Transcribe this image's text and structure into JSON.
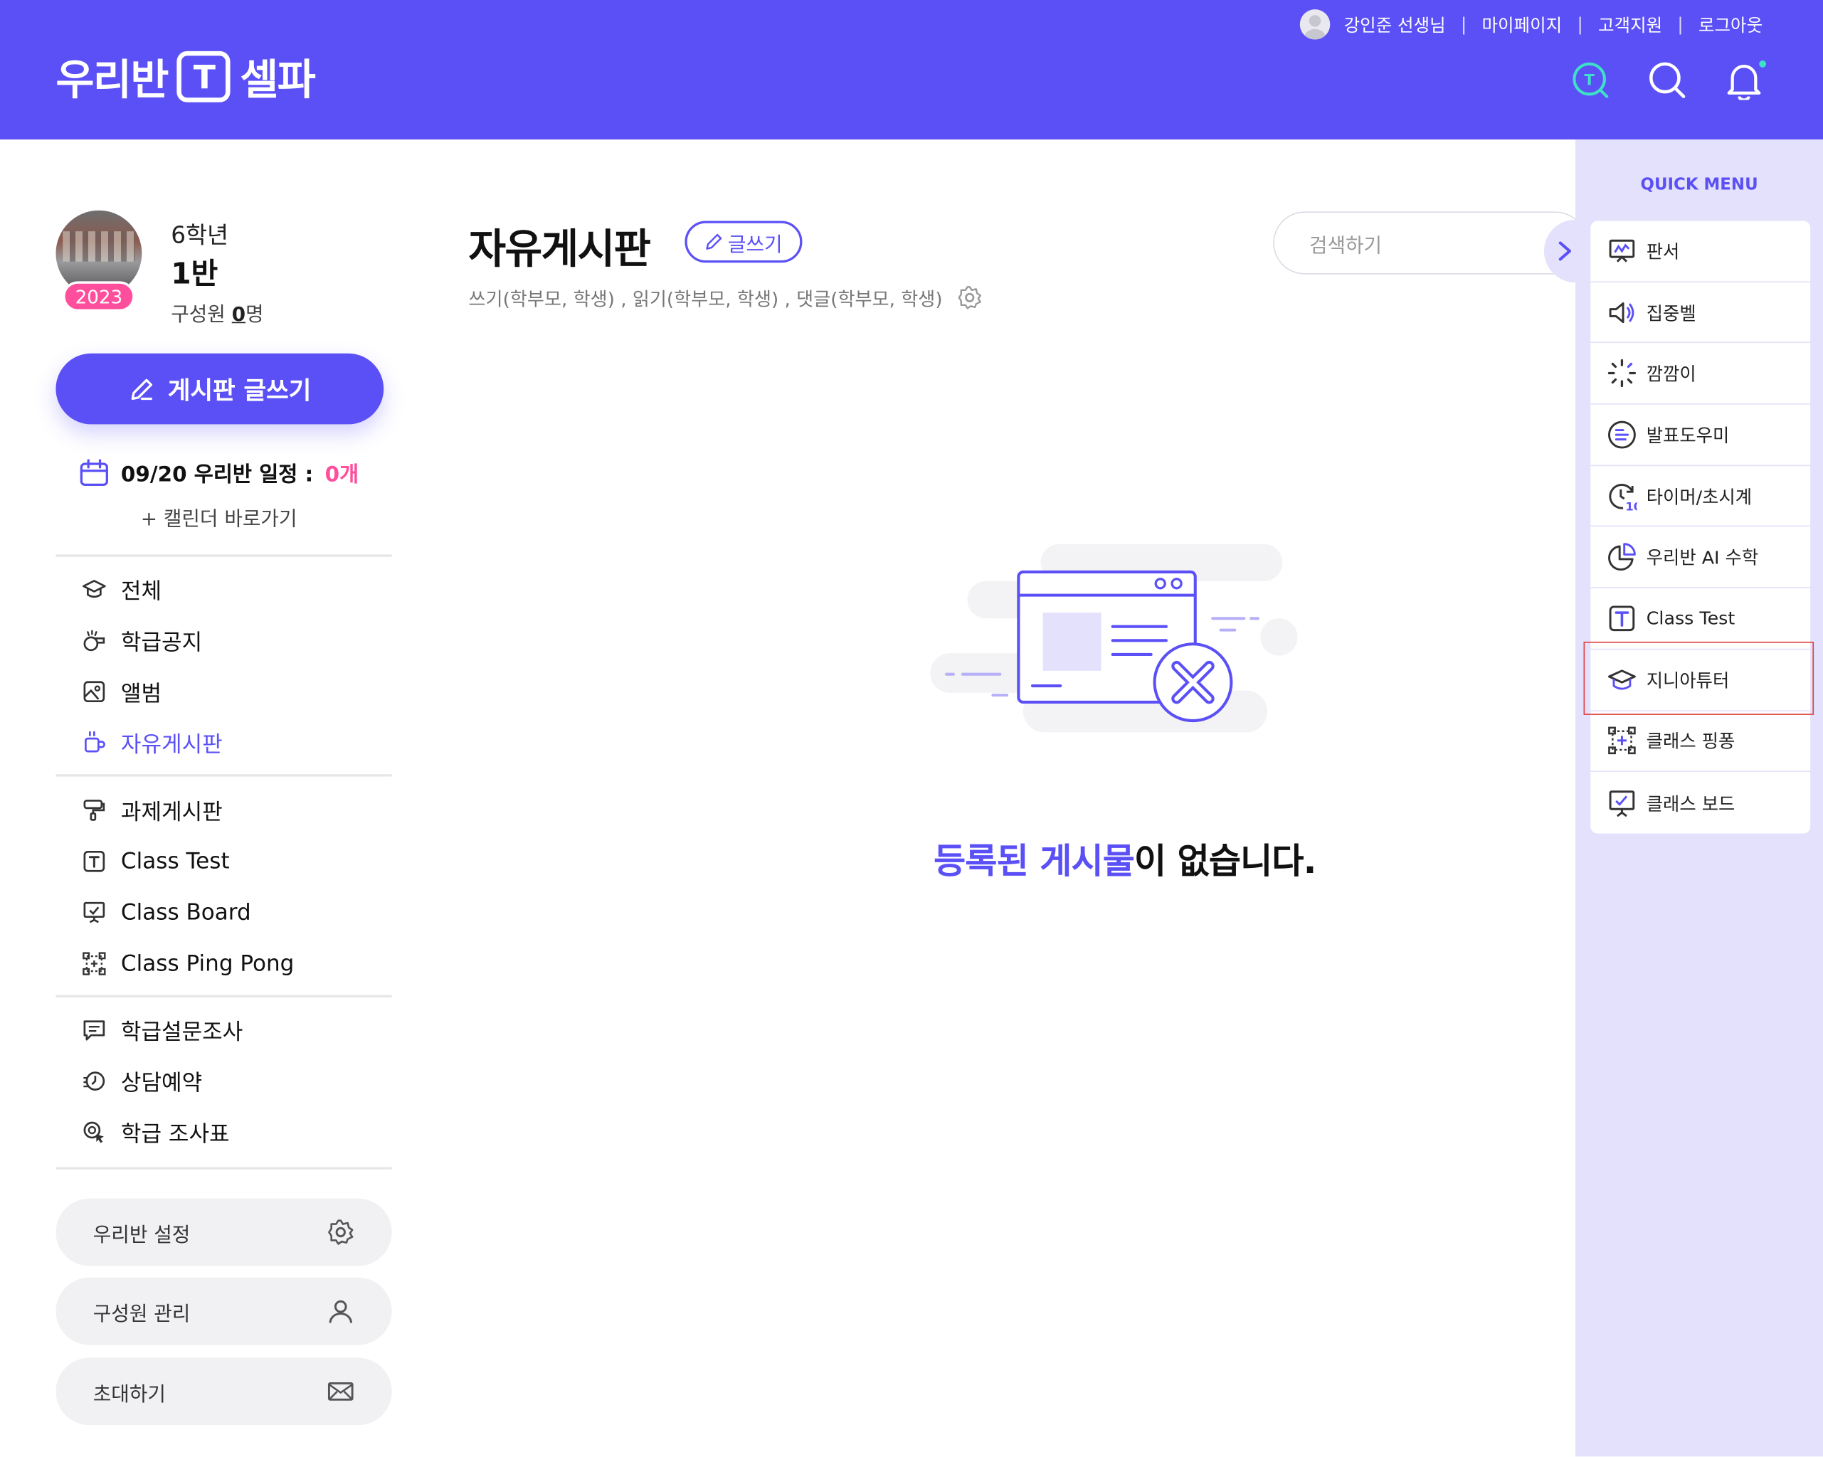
{
  "header": {
    "logo_left": "우리반",
    "logo_badge": "T",
    "logo_right": "셀파",
    "user_name": "강인준 선생님",
    "links": [
      "마이페이지",
      "고객지원",
      "로그아웃"
    ],
    "separator": "|"
  },
  "profile": {
    "grade": "6학년",
    "class_name": "1반",
    "year": "2023",
    "members_prefix": "구성원 ",
    "members_count": "0",
    "members_suffix": "명"
  },
  "sidebar": {
    "write_button": "게시판 글쓰기",
    "schedule_label": "09/20 우리반 일정 :",
    "schedule_count": "0개",
    "calendar_link": "+ 캘린더 바로가기",
    "group1": [
      {
        "label": "전체",
        "icon": "graduation-cap-icon"
      },
      {
        "label": "학급공지",
        "icon": "whistle-icon"
      },
      {
        "label": "앨범",
        "icon": "album-icon"
      },
      {
        "label": "자유게시판",
        "icon": "cup-icon",
        "active": true
      }
    ],
    "group2": [
      {
        "label": "과제게시판",
        "icon": "paint-roller-icon"
      },
      {
        "label": "Class Test",
        "icon": "class-test-icon"
      },
      {
        "label": "Class Board",
        "icon": "board-icon"
      },
      {
        "label": "Class Ping Pong",
        "icon": "ping-pong-icon"
      }
    ],
    "group3": [
      {
        "label": "학급설문조사",
        "icon": "survey-icon"
      },
      {
        "label": "상담예약",
        "icon": "clock-icon"
      },
      {
        "label": "학급 조사표",
        "icon": "search-pointer-icon"
      }
    ],
    "settings_label": "우리반 설정",
    "members_manage_label": "구성원 관리",
    "invite_label": "초대하기"
  },
  "main": {
    "title": "자유게시판",
    "write_label": "글쓰기",
    "permissions": "쓰기(학부모, 학생) , 읽기(학부모, 학생) , 댓글(학부모, 학생)",
    "search_placeholder": "검색하기",
    "empty_highlight": "등록된 게시물",
    "empty_rest": "이 없습니다."
  },
  "quick_menu": {
    "title": "QUICK MENU",
    "toggle": "›",
    "items": [
      {
        "label": "판서",
        "icon": "pen-board-icon"
      },
      {
        "label": "집중벨",
        "icon": "speaker-icon"
      },
      {
        "label": "깜깜이",
        "icon": "loading-icon"
      },
      {
        "label": "발표도우미",
        "icon": "list-circle-icon"
      },
      {
        "label": "타이머/초시계",
        "icon": "timer-icon"
      },
      {
        "label": "우리반 AI 수학",
        "icon": "pie-icon"
      },
      {
        "label": "Class Test",
        "icon": "class-test-icon"
      },
      {
        "label": "지니아튜터",
        "icon": "graduation-cap-icon"
      },
      {
        "label": "클래스 핑퐁",
        "icon": "ping-pong-icon"
      },
      {
        "label": "클래스 보드",
        "icon": "board-icon"
      }
    ]
  },
  "colors": {
    "brand": "#5b50f6",
    "accent_pink": "#ff4f9c",
    "panel": "#e3e1fb"
  }
}
